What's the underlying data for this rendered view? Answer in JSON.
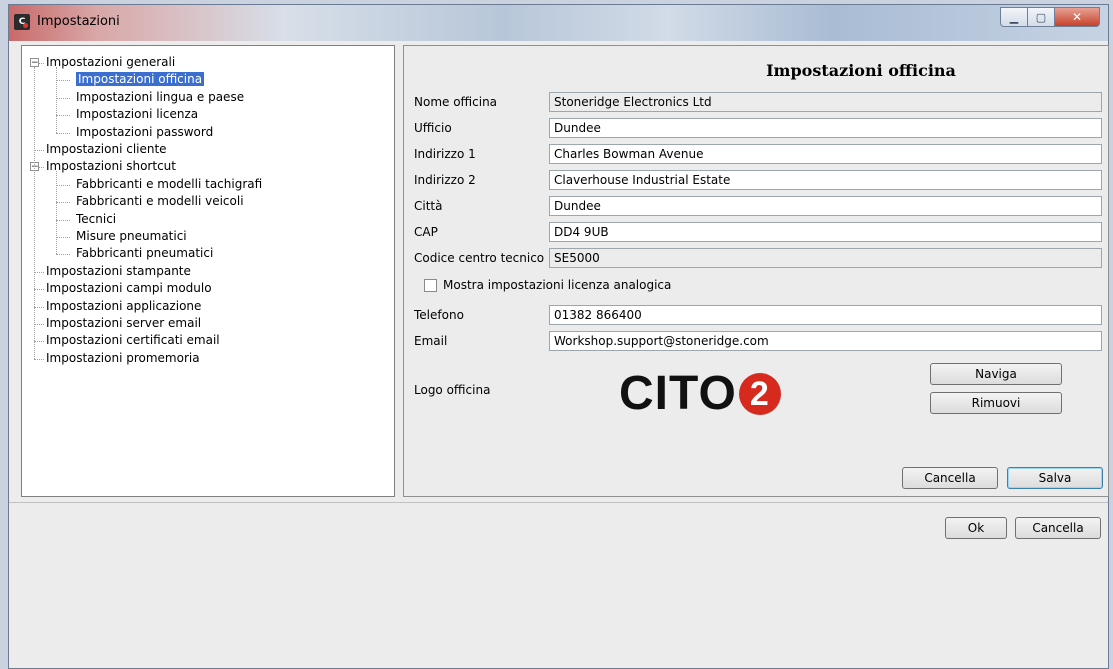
{
  "window": {
    "title": "Impostazioni",
    "icon_text": "C"
  },
  "tree": [
    {
      "label": "Impostazioni generali",
      "level": 0,
      "expanded": true
    },
    {
      "label": "Impostazioni officina",
      "level": 1,
      "selected": true
    },
    {
      "label": "Impostazioni lingua e paese",
      "level": 1
    },
    {
      "label": "Impostazioni licenza",
      "level": 1
    },
    {
      "label": "Impostazioni password",
      "level": 1
    },
    {
      "label": "Impostazioni cliente",
      "level": 0
    },
    {
      "label": "Impostazioni shortcut",
      "level": 0,
      "expanded": true
    },
    {
      "label": "Fabbricanti e modelli tachigrafi",
      "level": 1
    },
    {
      "label": "Fabbricanti e modelli veicoli",
      "level": 1
    },
    {
      "label": "Tecnici",
      "level": 1
    },
    {
      "label": "Misure pneumatici",
      "level": 1
    },
    {
      "label": "Fabbricanti pneumatici",
      "level": 1
    },
    {
      "label": "Impostazioni stampante",
      "level": 0
    },
    {
      "label": "Impostazioni campi modulo",
      "level": 0
    },
    {
      "label": "Impostazioni applicazione",
      "level": 0
    },
    {
      "label": "Impostazioni server email",
      "level": 0
    },
    {
      "label": "Impostazioni certificati email",
      "level": 0
    },
    {
      "label": "Impostazioni promemoria",
      "level": 0
    }
  ],
  "form": {
    "title": "Impostazioni officina",
    "fields": [
      {
        "label": "Nome officina",
        "value": "Stoneridge Electronics Ltd",
        "readonly": true
      },
      {
        "label": "Ufficio",
        "value": "Dundee"
      },
      {
        "label": "Indirizzo 1",
        "value": "Charles Bowman Avenue"
      },
      {
        "label": "Indirizzo 2",
        "value": "Claverhouse Industrial Estate"
      },
      {
        "label": "Città",
        "value": "Dundee"
      },
      {
        "label": "CAP",
        "value": "DD4 9UB"
      },
      {
        "label": "Codice centro tecnico",
        "value": "SE5000",
        "readonly": true
      }
    ],
    "checkbox_label": "Mostra impostazioni licenza analogica",
    "contact_fields": [
      {
        "label": "Telefono",
        "value": "01382 866400"
      },
      {
        "label": "Email",
        "value": "Workshop.support@stoneridge.com"
      }
    ],
    "logo_label": "Logo officina",
    "logo_text": "CITO",
    "logo_number": "2",
    "browse_label": "Naviga",
    "remove_label": "Rimuovi",
    "cancel_label": "Cancella",
    "save_label": "Salva"
  },
  "footer": {
    "ok_label": "Ok",
    "cancel_label": "Cancella"
  }
}
